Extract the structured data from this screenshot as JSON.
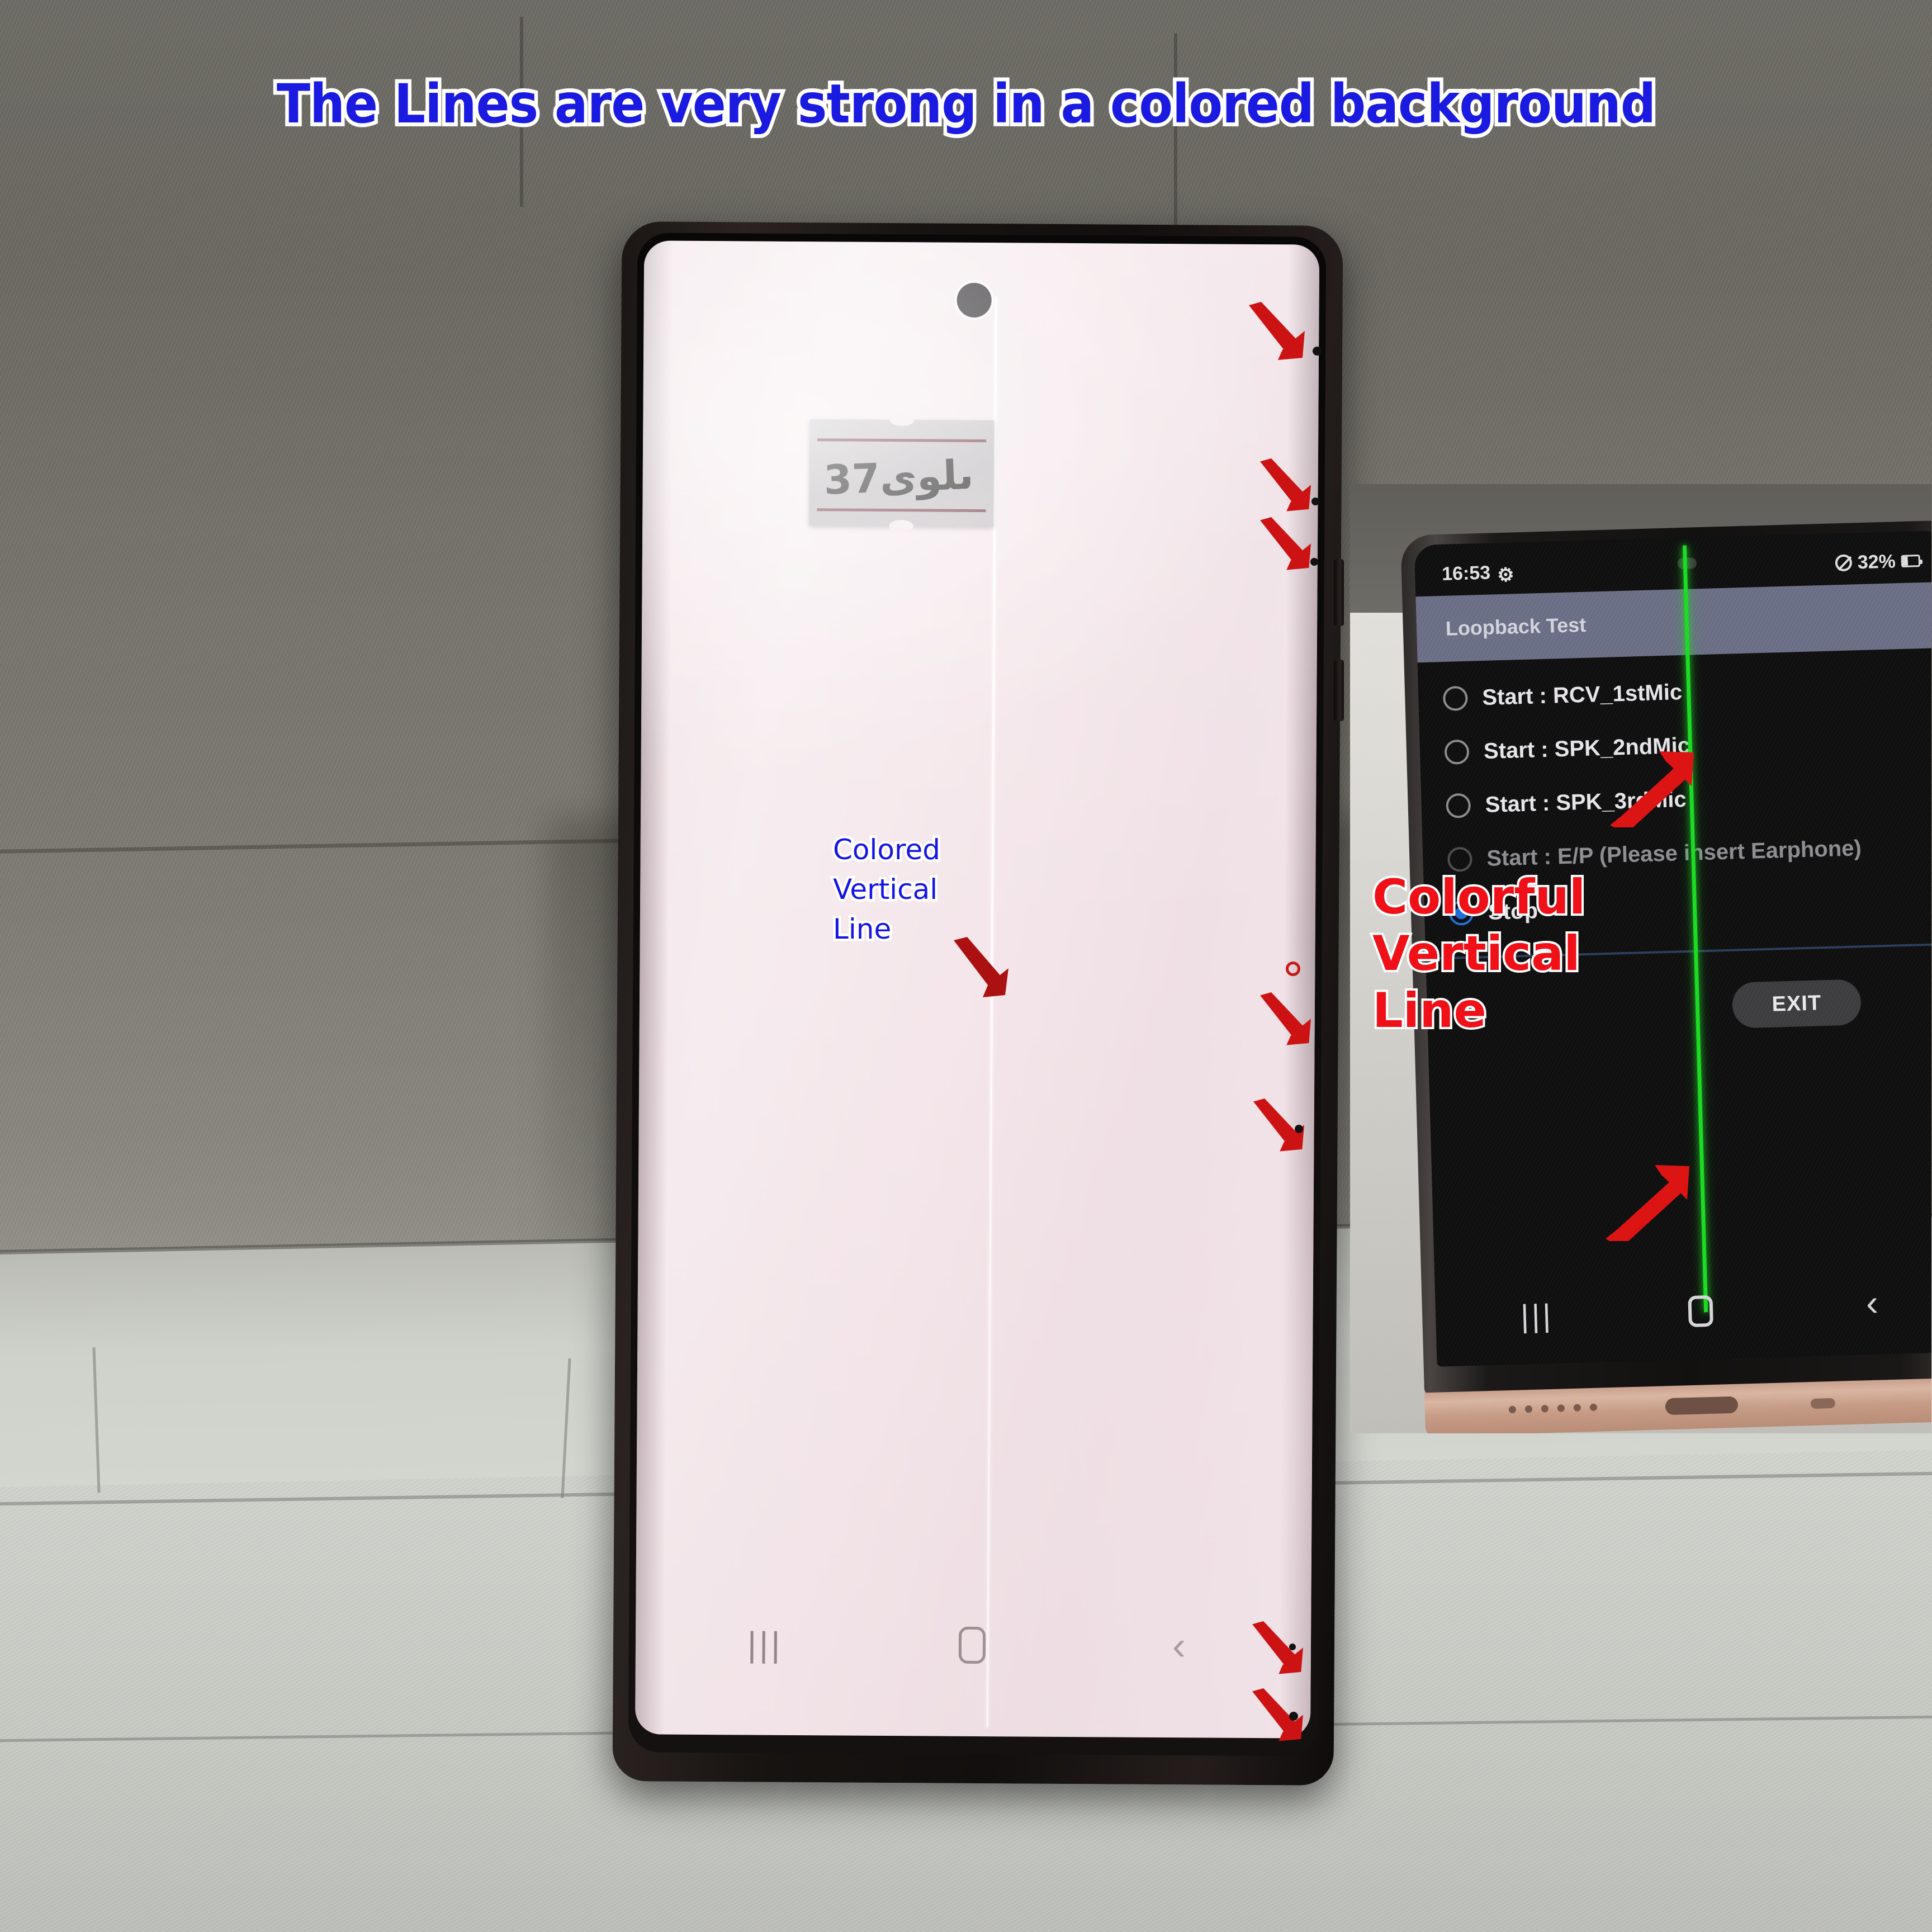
{
  "title": "The Lines are very strong in a colored background",
  "title_color": "#1a1ae0",
  "title_outline_color": "#ffffff",
  "main_phone": {
    "annotation": {
      "line1": "Colored",
      "line2": "Vertical",
      "line3": "Line",
      "color": "#1515e4",
      "outline_color": "#ffffff"
    },
    "sticker_text": "ىلوى37",
    "defect_line_color": "#ffffff",
    "screen_background_color": "#f3e7ec",
    "navbar": {
      "recents_icon": "recents-icon",
      "recents_glyph": "|||",
      "home_icon": "home-icon",
      "back_icon": "back-icon",
      "back_glyph": "‹"
    },
    "markers": {
      "arrow_color": "#cc1111",
      "dot_color": "#121010",
      "ring_color": "#c81818",
      "arrow_count": 7,
      "dot_count": 5
    }
  },
  "inset_phone": {
    "statusbar": {
      "time": "16:53",
      "gear_icon": "gear-icon",
      "mute_icon": "mute-icon",
      "battery_percent": "32%",
      "battery_icon": "battery-icon"
    },
    "appbar_title": "Loopback Test",
    "appbar_color": "#6c7087",
    "options": [
      {
        "label": "Start : RCV_1stMic",
        "selected": false,
        "enabled": true
      },
      {
        "label": "Start : SPK_2ndMic",
        "selected": false,
        "enabled": true
      },
      {
        "label": "Start : SPK_3rdMic",
        "selected": false,
        "enabled": true
      },
      {
        "label": "Start : E/P (Please insert Earphone)",
        "selected": false,
        "enabled": false
      },
      {
        "label": "Stop",
        "selected": true,
        "enabled": true
      }
    ],
    "exit_label": "EXIT",
    "defect_line_color": "#18e020",
    "annotation": {
      "line1": "Colorful",
      "line2": "Vertical",
      "line3": "Line",
      "color": "#f01018",
      "outline_color": "#ffffff"
    },
    "navbar": {
      "recents_icon": "recents-icon",
      "recents_glyph": "|||",
      "home_icon": "home-icon",
      "back_icon": "back-icon",
      "back_glyph": "‹"
    },
    "arrow_color": "#d81414",
    "arrow_count": 2
  }
}
